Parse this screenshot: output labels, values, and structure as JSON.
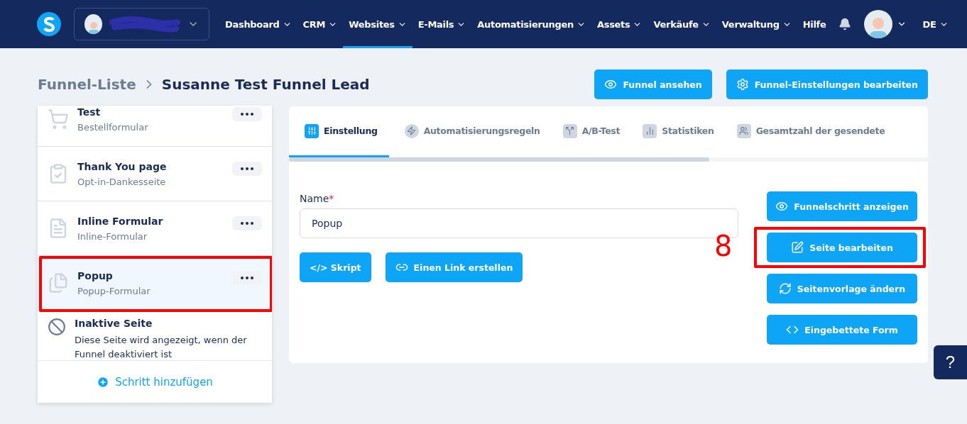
{
  "nav": {
    "items": [
      {
        "label": "Dashboard",
        "selected": false
      },
      {
        "label": "CRM",
        "selected": false
      },
      {
        "label": "Websites",
        "selected": true
      },
      {
        "label": "E-Mails",
        "selected": false
      },
      {
        "label": "Automatisierungen",
        "selected": false
      },
      {
        "label": "Assets",
        "selected": false
      },
      {
        "label": "Verkäufe",
        "selected": false
      },
      {
        "label": "Verwaltung",
        "selected": false
      }
    ],
    "help": "Hilfe",
    "language": "DE"
  },
  "breadcrumb": {
    "parent": "Funnel-Liste",
    "current": "Susanne Test Funnel Lead"
  },
  "header_buttons": [
    "Funnel ansehen",
    "Funnel-Einstellungen bearbeiten"
  ],
  "steps": [
    {
      "kind": "cart",
      "title": "Test",
      "subtitle": "Bestellformular",
      "selected": false,
      "annotated": false
    },
    {
      "kind": "clipboard",
      "title": "Thank You page",
      "subtitle": "Opt-in-Dankesseite",
      "selected": false,
      "annotated": false
    },
    {
      "kind": "document",
      "title": "Inline Formular",
      "subtitle": "Inline-Formular",
      "selected": false,
      "annotated": false
    },
    {
      "kind": "popup",
      "title": "Popup",
      "subtitle": "Popup-Formular",
      "selected": true,
      "annotated": true
    }
  ],
  "inactive": {
    "title": "Inaktive Seite",
    "text": "Diese Seite wird angezeigt, wenn der Funnel deaktiviert ist"
  },
  "add_step": "Schritt hinzufügen",
  "tabs": [
    {
      "kind": "settings",
      "label": "Einstellung",
      "selected": true
    },
    {
      "kind": "bolt",
      "label": "Automatisierungsregeln",
      "selected": false
    },
    {
      "kind": "split",
      "label": "A/B-Test",
      "selected": false
    },
    {
      "kind": "chart",
      "label": "Statistiken",
      "selected": false
    },
    {
      "kind": "people",
      "label": "Gesamtzahl der gesendete",
      "selected": false
    }
  ],
  "form": {
    "label": "Name",
    "required_mark": "*",
    "value": "Popup",
    "buttons": [
      {
        "kind": "code",
        "label": "</> Skript"
      },
      {
        "kind": "link",
        "label": "Einen Link erstellen"
      }
    ]
  },
  "actions": [
    {
      "kind": "eye",
      "label": "Funnelschritt anzeigen",
      "annotated": false
    },
    {
      "kind": "edit",
      "label": "Seite bearbeiten",
      "annotated": true
    },
    {
      "kind": "refresh",
      "label": "Seitenvorlage ändern",
      "annotated": false
    },
    {
      "kind": "embed",
      "label": "Eingebettete Form",
      "annotated": false
    }
  ],
  "annotation_number": "8",
  "help_button": "?"
}
